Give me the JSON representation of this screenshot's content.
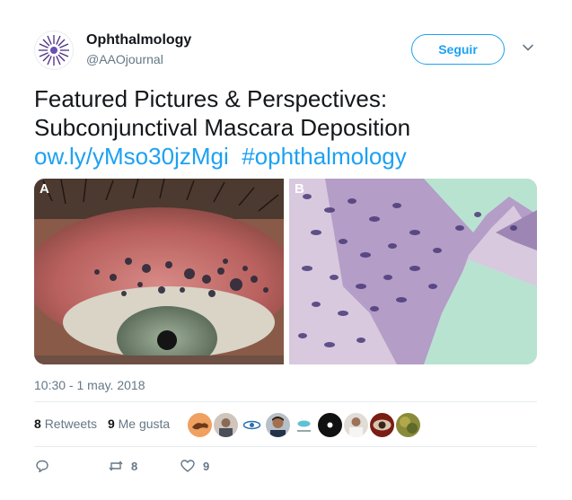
{
  "author": {
    "name": "Ophthalmology",
    "handle": "@AAOjournal"
  },
  "follow_label": "Seguir",
  "tweet": {
    "line1": "Featured Pictures & Perspectives:",
    "line2": "Subconjunctival Mascara Deposition",
    "link": "ow.ly/yMso30jzMgi",
    "hashtag": "#ophthalmology"
  },
  "media": {
    "panel_a_label": "A",
    "panel_b_label": "B"
  },
  "timestamp": "10:30 - 1 may. 2018",
  "stats": {
    "retweets_count": "8",
    "retweets_label": "Retweets",
    "likes_count": "9",
    "likes_label": "Me gusta"
  },
  "actions": {
    "retweet_count": "8",
    "like_count": "9"
  },
  "colors": {
    "link": "#1da1f2",
    "secondary_text": "#657786",
    "primary_text": "#14171a"
  }
}
